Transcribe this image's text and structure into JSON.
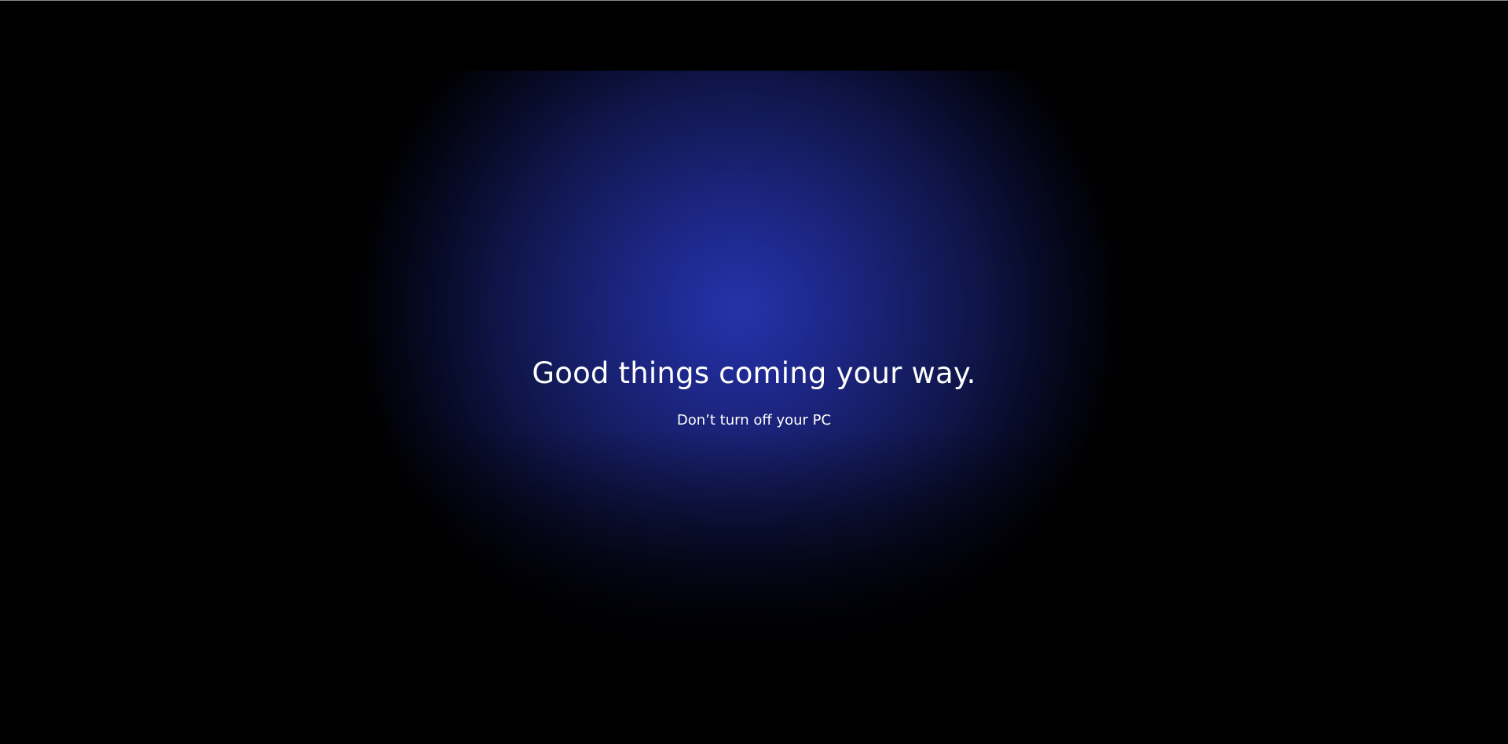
{
  "screen": {
    "headline": "Good things coming your way.",
    "subline": "Don’t turn off your PC"
  },
  "colors": {
    "background": "#000000",
    "glow_center": "#2433a8",
    "text": "#ffffff"
  }
}
